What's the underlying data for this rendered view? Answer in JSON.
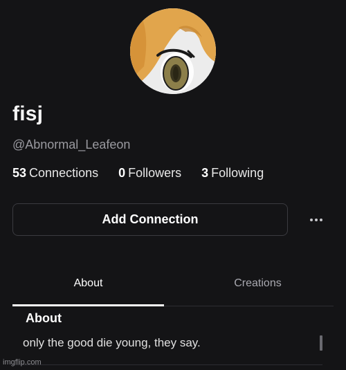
{
  "profile": {
    "display_name": "fisj",
    "username": "@Abnormal_Leafeon"
  },
  "stats": [
    {
      "count": "53",
      "label": "Connections"
    },
    {
      "count": "0",
      "label": "Followers"
    },
    {
      "count": "3",
      "label": "Following"
    }
  ],
  "actions": {
    "add_connection_label": "Add Connection",
    "more_icon": "more-horizontal-icon"
  },
  "tabs": [
    {
      "label": "About",
      "active": true
    },
    {
      "label": "Creations",
      "active": false
    }
  ],
  "about": {
    "heading": "About",
    "text": "only the good die young, they say."
  },
  "watermark": "imgflip.com",
  "colors": {
    "background": "#141416",
    "hair": "#e1a54c",
    "eye_iris": "#8c7f4a",
    "muted_text": "#9a9aa0"
  }
}
